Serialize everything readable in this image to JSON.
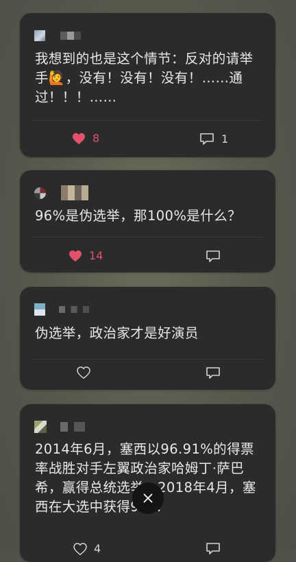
{
  "comments": [
    {
      "text": "我想到的也是这个情节：反对的请举手🙋，没有！没有！没有！……通过！！！……",
      "likes": "8",
      "liked": true,
      "replies": "1"
    },
    {
      "text": "96%是伪选举，那100%是什么？",
      "likes": "14",
      "liked": true,
      "replies": ""
    },
    {
      "text": "伪选举，政治家才是好演员",
      "likes": "",
      "liked": false,
      "replies": ""
    },
    {
      "text": "2014年6月，塞西以96.91%的得票率战胜对手左翼政治家哈姆丁·萨巴希，赢得总统选举。2018年4月，塞西在大选中获得97…",
      "likes": "4",
      "liked": false,
      "replies": ""
    }
  ],
  "colors": {
    "liked": "#e2516b",
    "card": "#2b2b2b",
    "text": "#e9e9e9"
  },
  "icons": {
    "like": "heart-icon",
    "reply": "comment-icon",
    "close": "close-icon"
  }
}
